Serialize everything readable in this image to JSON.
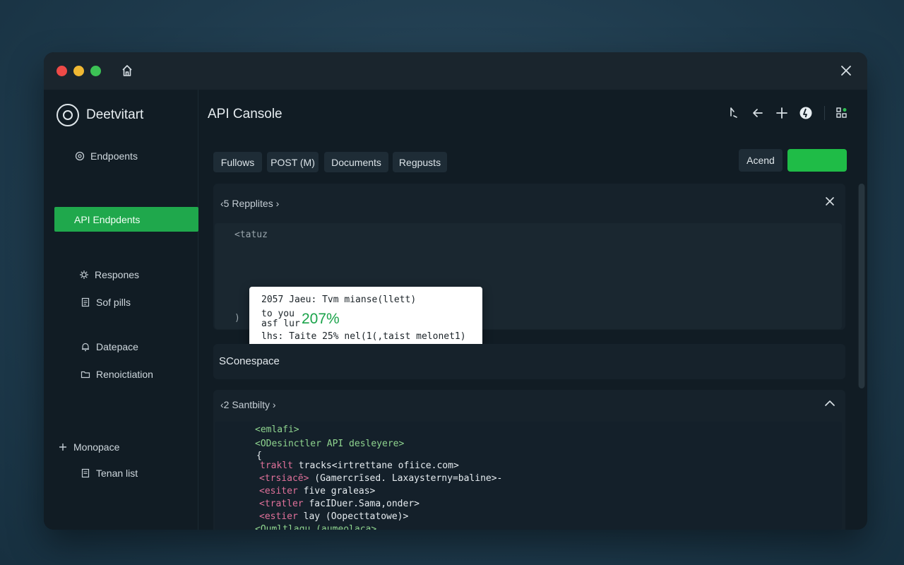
{
  "app": {
    "brand": "Deetvitart",
    "title": "API Cansole"
  },
  "sidebar": {
    "items": [
      {
        "label": "Endpoents",
        "icon": "circle-icon"
      },
      {
        "label": "API Endpdents",
        "icon": "none",
        "active": true
      },
      {
        "label": "Respones",
        "icon": "gear-icon"
      },
      {
        "label": "Sof pills",
        "icon": "doc-icon"
      },
      {
        "label": "Datepace",
        "icon": "bell-icon"
      },
      {
        "label": "Renoictiation",
        "icon": "folder-icon"
      },
      {
        "label": "Monopace",
        "icon": "plus-icon"
      },
      {
        "label": "Tenan list",
        "icon": "doc-icon"
      }
    ]
  },
  "tabs": [
    "Fullows",
    "POST (M)",
    "Documents",
    "Regpusts"
  ],
  "actions": {
    "send_label": "Acend",
    "green_button_label": ""
  },
  "panel_responses": {
    "header": "‹5 Repplites ›",
    "open_tag": "<tatuz",
    "close_brace": ")",
    "popup": {
      "line1": "2057 Jaeu: Tvm mianse(llett)",
      "line2a": "to you",
      "line2b": "asf lur",
      "percent": "207%",
      "line3": "lhs: Taite 25% nel(1(,taist melonet1)"
    }
  },
  "panel_section": {
    "label": "SConespace"
  },
  "panel_security": {
    "header": "‹2 Santbilty ›",
    "lines": [
      {
        "text": "<emlafi>",
        "color": "green"
      },
      {
        "text": "<ODesinctler API desleyere>",
        "color": "green"
      },
      {
        "text": "{",
        "color": "white"
      },
      {
        "pre": "traklt",
        "text": " tracks<irtrettane ofiice.com>",
        "color": "pink"
      },
      {
        "pre": "<trsiacē>",
        "text": " (Gamercrīsed. Laxaysterny=baline>-",
        "color": "pink"
      },
      {
        "pre": "<esiter",
        "text": " five graleas>",
        "color": "pink"
      },
      {
        "pre": "<tratler",
        "text": " facIDuer.Sama,onder>",
        "color": "pink"
      },
      {
        "pre": "<estier",
        "text": " lay (Oopecttatowe)>",
        "color": "pink"
      },
      {
        "text": "<Oumltlaqu (aumeolaca>",
        "color": "green"
      }
    ]
  },
  "colors": {
    "accent_green": "#1fa84c",
    "background": "#111c24"
  }
}
